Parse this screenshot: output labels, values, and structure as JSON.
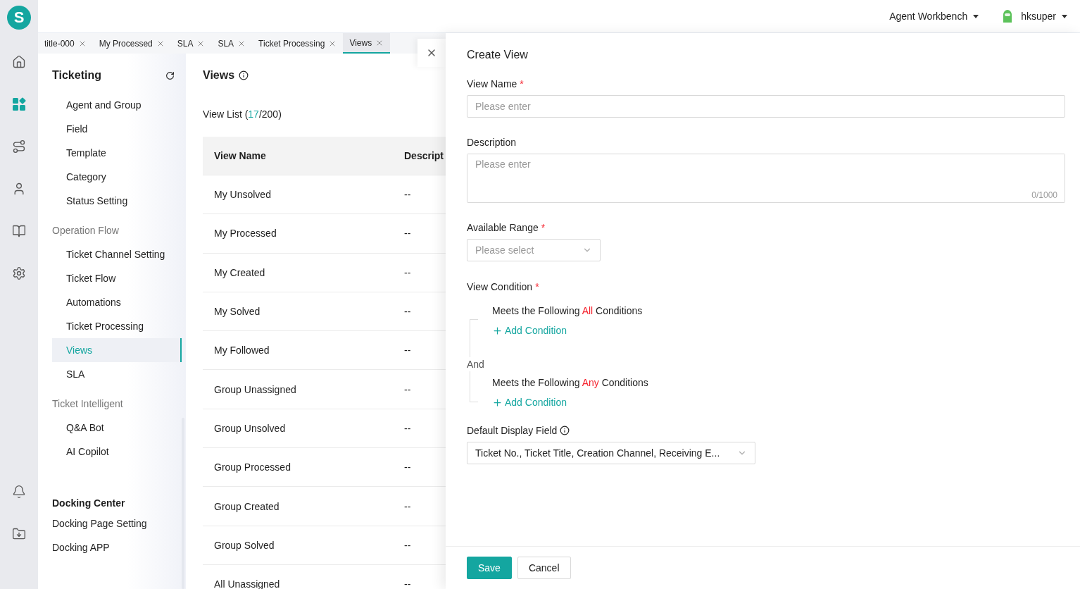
{
  "rail": {
    "logo": "S",
    "items": [
      {
        "selected": false
      },
      {
        "selected": true
      },
      {
        "selected": false
      },
      {
        "selected": false
      },
      {
        "selected": false
      },
      {
        "selected": false
      }
    ]
  },
  "header": {
    "workbench": "Agent Workbench",
    "user": "hksuper"
  },
  "tabs": [
    {
      "label": "title-000",
      "selected": false
    },
    {
      "label": "My Processed",
      "selected": false
    },
    {
      "label": "SLA",
      "selected": false
    },
    {
      "label": "SLA",
      "selected": false
    },
    {
      "label": "Ticket Processing",
      "selected": false
    },
    {
      "label": "Views",
      "selected": true
    }
  ],
  "sidebar": {
    "title": "Ticketing",
    "sections": [
      {
        "items": [
          {
            "label": "Agent and Group",
            "selected": false
          },
          {
            "label": "Field",
            "selected": false
          },
          {
            "label": "Template",
            "selected": false
          },
          {
            "label": "Category",
            "selected": false
          },
          {
            "label": "Status Setting",
            "selected": false
          }
        ]
      },
      {
        "heading": "Operation Flow",
        "items": [
          {
            "label": "Ticket Channel Setting",
            "selected": false
          },
          {
            "label": "Ticket Flow",
            "selected": false
          },
          {
            "label": "Automations",
            "selected": false
          },
          {
            "label": "Ticket Processing",
            "selected": false
          },
          {
            "label": "Views",
            "selected": true
          },
          {
            "label": "SLA",
            "selected": false
          }
        ]
      },
      {
        "heading": "Ticket Intelligent",
        "items": [
          {
            "label": "Q&A Bot",
            "selected": false
          },
          {
            "label": "AI Copilot",
            "selected": false
          }
        ]
      }
    ],
    "docking": {
      "title": "Docking Center",
      "items": [
        "Docking Page Setting",
        "Docking APP"
      ]
    }
  },
  "main": {
    "title": "Views",
    "list_label": "View List (",
    "count": "17",
    "total": "/200)",
    "table": {
      "columns": [
        "View Name",
        "Descript"
      ],
      "rows": [
        [
          "My Unsolved",
          "--"
        ],
        [
          "My Processed",
          "--"
        ],
        [
          "My Created",
          "--"
        ],
        [
          "My Solved",
          "--"
        ],
        [
          "My Followed",
          "--"
        ],
        [
          "Group Unassigned",
          "--"
        ],
        [
          "Group Unsolved",
          "--"
        ],
        [
          "Group Processed",
          "--"
        ],
        [
          "Group Created",
          "--"
        ],
        [
          "Group Solved",
          "--"
        ],
        [
          "All Unassigned",
          "--"
        ]
      ]
    }
  },
  "drawer": {
    "title": "Create View",
    "view_name": {
      "label": "View Name",
      "required_mark": "*",
      "placeholder": "Please enter"
    },
    "description": {
      "label": "Description",
      "placeholder": "Please enter",
      "counter": "0/1000"
    },
    "range": {
      "label": "Available Range",
      "required_mark": "*",
      "placeholder": "Please select"
    },
    "condition": {
      "label": "View Condition",
      "required_mark": "*",
      "joiner": "And",
      "groups": [
        {
          "lead": "Meets the Following ",
          "keyword": "All",
          "tail": " Conditions",
          "action": "Add Condition"
        },
        {
          "lead": "Meets the Following ",
          "keyword": "Any",
          "tail": " Conditions",
          "action": "Add Condition"
        }
      ]
    },
    "display": {
      "label": "Default Display Field",
      "value": "Ticket No., Ticket Title, Creation Channel, Receiving E..."
    },
    "buttons": [
      {
        "label": "Save",
        "kind": "primary"
      },
      {
        "label": "Cancel",
        "kind": "default"
      }
    ]
  }
}
